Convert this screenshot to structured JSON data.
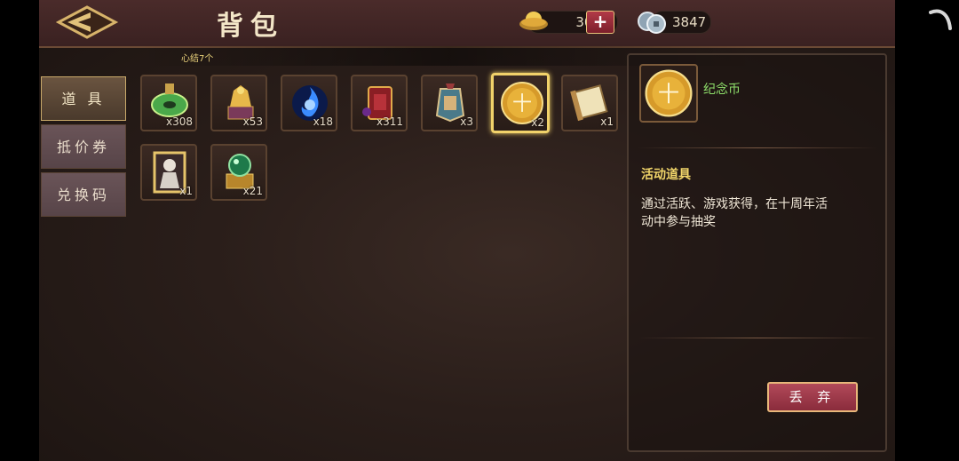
{
  "header": {
    "title": "背包"
  },
  "currency": {
    "gold": "302",
    "plus": "+",
    "silver": "3847"
  },
  "hint": "心结7个",
  "tabs": [
    {
      "label": "道 具",
      "active": true
    },
    {
      "label": "抵价券",
      "active": false
    },
    {
      "label": "兑换码",
      "active": false
    }
  ],
  "items": [
    {
      "icon": "jade-disc-icon",
      "qty": "x308"
    },
    {
      "icon": "golden-qilin-icon",
      "qty": "x53"
    },
    {
      "icon": "blue-flame-icon",
      "qty": "x18"
    },
    {
      "icon": "red-pouch-icon",
      "qty": "x311"
    },
    {
      "icon": "blue-pouch-icon",
      "qty": "x3"
    },
    {
      "icon": "commemorative-coin-icon",
      "qty": "x2",
      "selected": true,
      "coin_char": "十"
    },
    {
      "icon": "scroll-icon",
      "qty": "x1"
    },
    {
      "icon": "character-card-icon",
      "qty": "x1"
    },
    {
      "icon": "green-orb-icon",
      "qty": "x21"
    }
  ],
  "detail": {
    "icon": "commemorative-coin-icon",
    "coin_char": "十",
    "name": "纪念币",
    "category": "活动道具",
    "description": "通过活跃、游戏获得，在十周年活动中参与抽奖",
    "discard_label": "丢 弃"
  },
  "colors": {
    "accent_gold": "#f1d26a",
    "name_green": "#8fe06b",
    "button_red": "#9a3444"
  }
}
